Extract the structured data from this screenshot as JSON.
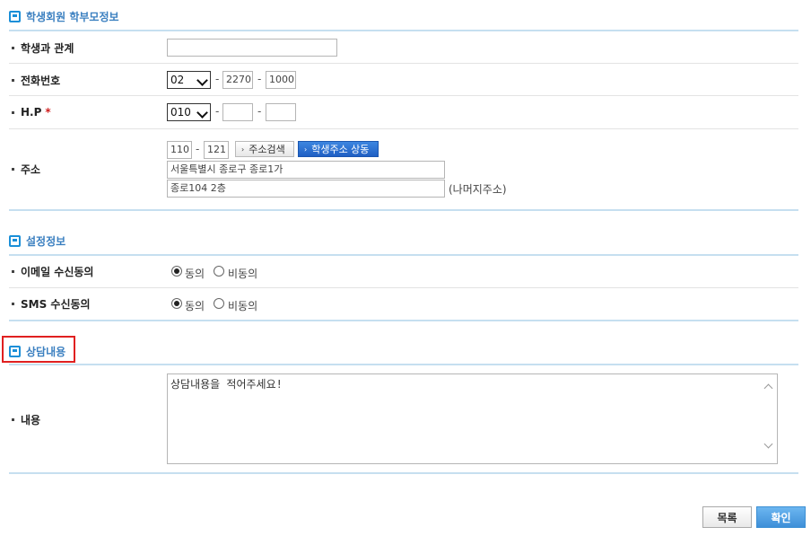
{
  "sections": {
    "parent_info": "학생회원 학부모정보",
    "settings": "설정정보",
    "consult": "상담내용"
  },
  "fields": {
    "relation": {
      "label": "학생과 관계",
      "value": ""
    },
    "phone": {
      "label": "전화번호",
      "area": "02",
      "mid": "2270",
      "last": "1000"
    },
    "hp": {
      "label": "H.P",
      "required_mark": "*",
      "prefix": "010",
      "mid": "",
      "last": ""
    },
    "address": {
      "label": "주소",
      "zip1": "110",
      "zip2": "121",
      "search_button": "주소검색",
      "same_button": "학생주소 상동",
      "line1": "서울특별시 종로구 종로1가",
      "line2": "종로104 2층",
      "remainder_hint": "(나머지주소)"
    },
    "email_consent": {
      "label": "이메일 수신동의",
      "agree": "동의",
      "disagree": "비동의",
      "selected": "동의"
    },
    "sms_consent": {
      "label": "SMS 수신동의",
      "agree": "동의",
      "disagree": "비동의",
      "selected": "동의"
    },
    "content": {
      "label": "내용",
      "value": "상담내용을 적어주세요!"
    }
  },
  "buttons": {
    "list": "목록",
    "confirm": "확인"
  },
  "colors": {
    "section_title": "#3a7fc0",
    "accent_line": "#c6dff0",
    "highlight_box": "#e02020",
    "primary_button": "#3e8fd8"
  }
}
